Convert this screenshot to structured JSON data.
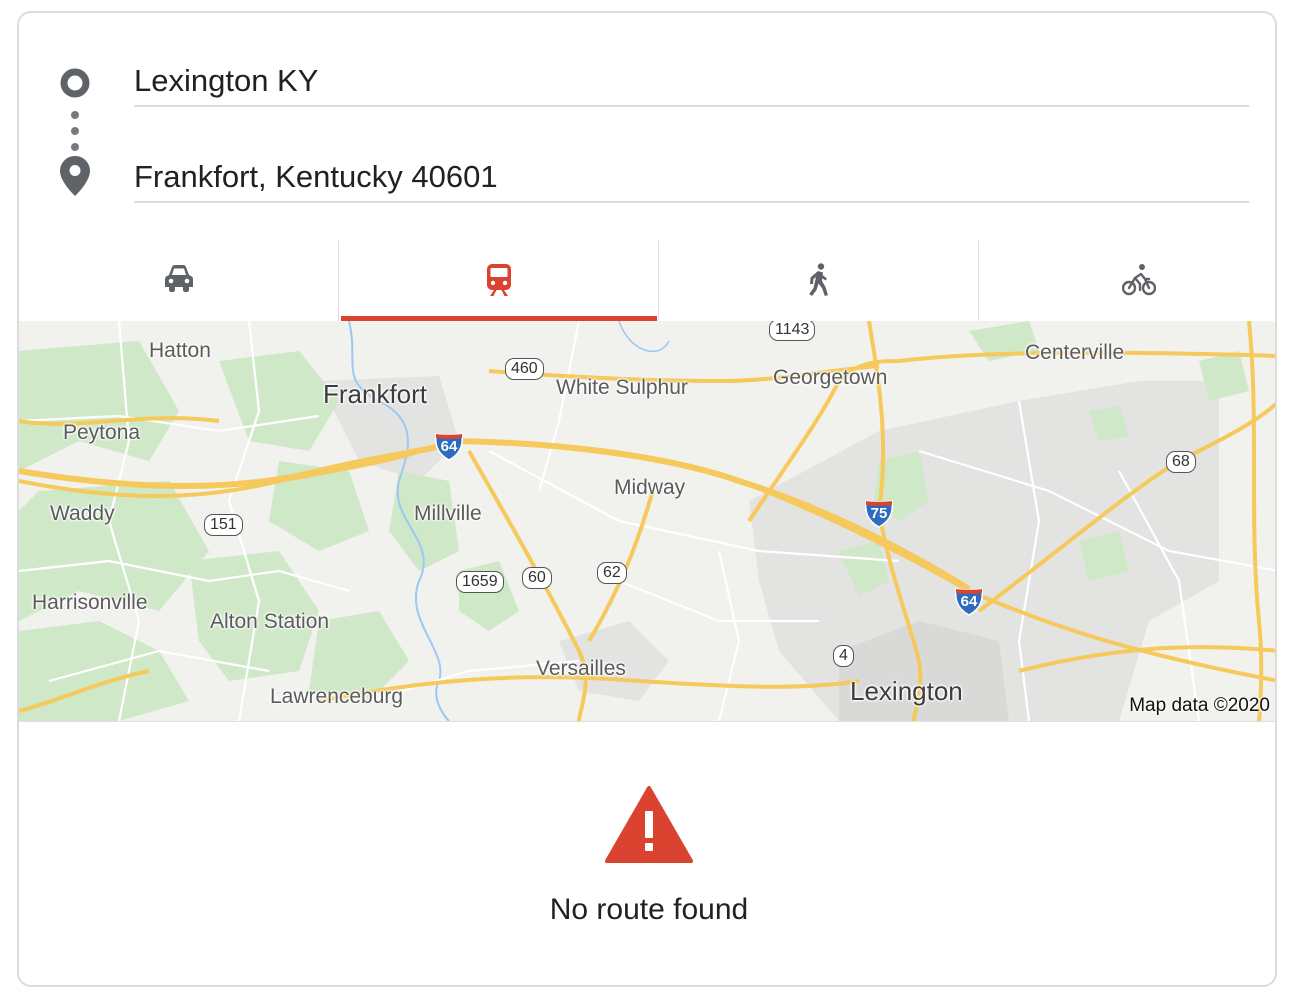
{
  "directions": {
    "origin_value": "Lexington KY",
    "destination_value": "Frankfort, Kentucky 40601",
    "origin_icon": "origin-circle-icon",
    "destination_icon": "location-pin-icon"
  },
  "travel_modes": [
    {
      "name": "driving",
      "icon": "car-icon",
      "selected": false
    },
    {
      "name": "transit",
      "icon": "train-icon",
      "selected": true
    },
    {
      "name": "walking",
      "icon": "walk-icon",
      "selected": false
    },
    {
      "name": "cycling",
      "icon": "bicycle-icon",
      "selected": false
    }
  ],
  "map": {
    "places": {
      "hatton": "Hatton",
      "frankfort": "Frankfort",
      "white_sulphur": "White Sulphur",
      "georgetown": "Georgetown",
      "centerville": "Centerville",
      "peytona": "Peytona",
      "midway": "Midway",
      "waddy": "Waddy",
      "millville": "Millville",
      "harrisonville": "Harrisonville",
      "alton_station": "Alton Station",
      "versailles": "Versailles",
      "lawrenceburg": "Lawrenceburg",
      "lexington": "Lexington"
    },
    "route_shields": {
      "r1143": "1143",
      "r460": "460",
      "r151": "151",
      "r1659": "1659",
      "r60": "60",
      "r62": "62",
      "r68": "68",
      "r4": "4"
    },
    "interstates": {
      "i64_west": "64",
      "i75": "75",
      "i64_east": "64"
    },
    "attribution": "Map data ©2020"
  },
  "result": {
    "message": "No route found",
    "icon": "warning-icon"
  },
  "colors": {
    "accent": "#d9432f",
    "icon_gray": "#5f6368",
    "highway": "#f9d56b",
    "interstate_blue": "#2e6bbf",
    "interstate_red": "#d9432f",
    "park_green": "#cfe8c7"
  }
}
